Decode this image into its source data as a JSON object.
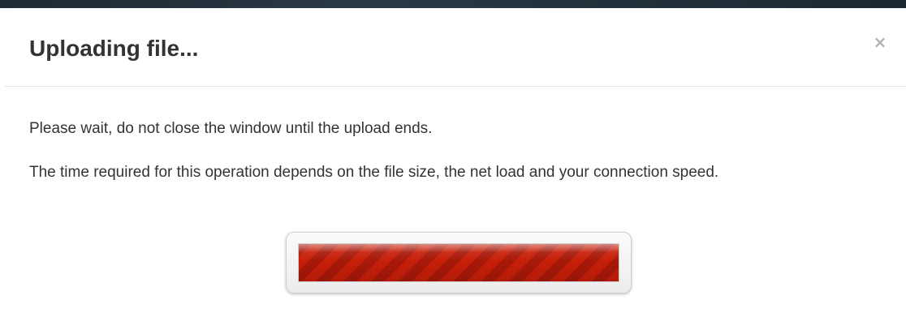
{
  "dialog": {
    "title": "Uploading file...",
    "close_glyph": "×",
    "close_icon": "close-icon",
    "messages": [
      "Please wait, do not close the window until the upload ends.",
      "The time required for this operation depends on the file size, the net load and your connection speed."
    ],
    "progress": {
      "fraction": 1.0,
      "style": "striped-animated",
      "color": "#c41f0a"
    }
  },
  "colors": {
    "title_text": "#333333",
    "body_text": "#333333",
    "close_icon": "#b3b3b3",
    "divider": "#e5e5e5",
    "backdrop": "#22303b"
  }
}
